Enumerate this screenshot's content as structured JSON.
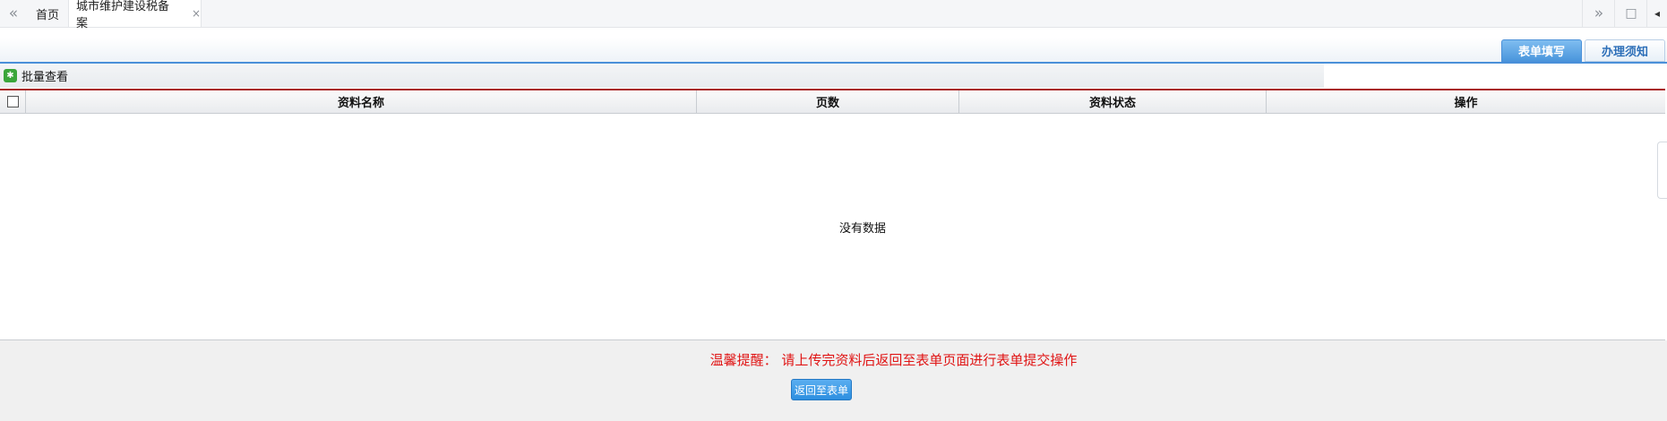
{
  "tabstrip": {
    "prev_icon": "«",
    "home_label": "首页",
    "active_tab_label": "城市维护建设税备案",
    "close_icon": "×",
    "next_icon": "»",
    "maximize_icon": "□",
    "more_icon": "◂"
  },
  "view_tabs": {
    "form": "表单填写",
    "notice": "办理须知"
  },
  "toolbar": {
    "batch_view_icon": "✱",
    "batch_view_label": "批量查看"
  },
  "table": {
    "columns": [
      "资料名称",
      "页数",
      "资料状态",
      "操作"
    ],
    "empty_text": "没有数据"
  },
  "footer": {
    "reminder": "温馨提醒：  请上传完资料后返回至表单页面进行表单提交操作",
    "return_button": "返回至表单"
  },
  "colors": {
    "accent_blue": "#4a96dc",
    "header_rule_red": "#a82020",
    "reminder_red": "#e01515",
    "batch_icon_green": "#3aa63a"
  }
}
